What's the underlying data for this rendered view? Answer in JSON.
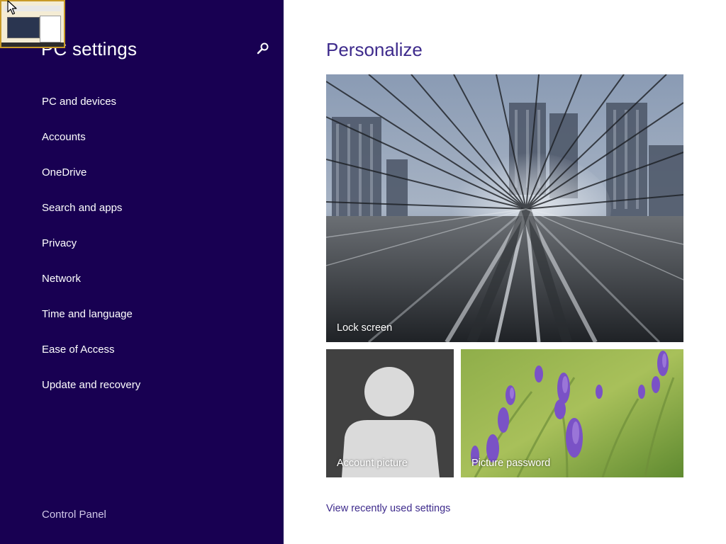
{
  "colors": {
    "sidebar_bg": "#180052",
    "accent": "#3e2b8c",
    "account_tile_bg": "#414141"
  },
  "sidebar": {
    "title": "PC settings",
    "search_icon": "search-icon",
    "items": [
      {
        "label": "PC and devices"
      },
      {
        "label": "Accounts"
      },
      {
        "label": "OneDrive"
      },
      {
        "label": "Search and apps"
      },
      {
        "label": "Privacy"
      },
      {
        "label": "Network"
      },
      {
        "label": "Time and language"
      },
      {
        "label": "Ease of Access"
      },
      {
        "label": "Update and recovery"
      }
    ],
    "footer_link": "Control Panel"
  },
  "main": {
    "title": "Personalize",
    "tiles": {
      "lock_screen": "Lock screen",
      "account_picture": "Account picture",
      "picture_password": "Picture password"
    },
    "recent_link": "View recently used settings"
  }
}
